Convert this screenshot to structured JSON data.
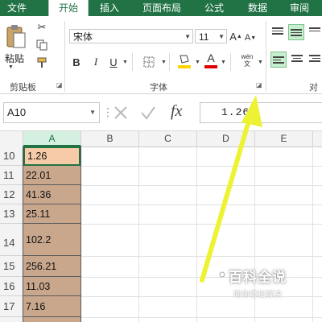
{
  "tabs": [
    "文件",
    "开始",
    "插入",
    "页面布局",
    "公式",
    "数据",
    "审阅"
  ],
  "clipboard": {
    "paste_label": "粘贴",
    "group_label": "剪贴板"
  },
  "font": {
    "name": "宋体",
    "size": "11",
    "group_label": "字体",
    "bold": "B",
    "italic": "I",
    "underline": "U",
    "wen": "wén\n文"
  },
  "alignment": {
    "group_label": "对齐"
  },
  "namebox": "A10",
  "formula": {
    "fx": "fx",
    "value": "1.26"
  },
  "columns": [
    "A",
    "B",
    "C",
    "D",
    "E"
  ],
  "rows": [
    {
      "num": "10",
      "value": "1.26"
    },
    {
      "num": "11",
      "value": "22.01"
    },
    {
      "num": "12",
      "value": "41.36"
    },
    {
      "num": "13",
      "value": "25.11"
    },
    {
      "num": "14",
      "value": "102.2"
    },
    {
      "num": "15",
      "value": "256.21"
    },
    {
      "num": "16",
      "value": "11.03"
    },
    {
      "num": "17",
      "value": "7.16"
    }
  ],
  "watermark": {
    "title": "百科全说",
    "subtitle": "助你轻松解决"
  },
  "colors": {
    "excel_green": "#217346",
    "selected_fill": "#c9a78d",
    "active_fill": "#f7cba8",
    "arrow_yellow": "#eef235"
  }
}
